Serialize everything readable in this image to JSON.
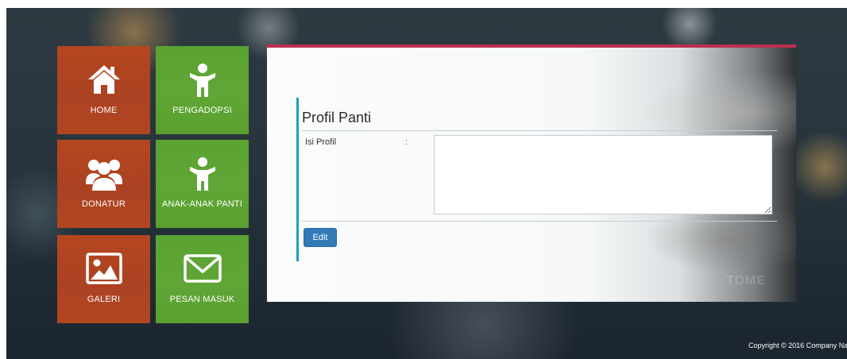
{
  "tiles": [
    {
      "label": "HOME",
      "icon": "home-icon",
      "color": "#b5461f"
    },
    {
      "label": "PENGADOPSI",
      "icon": "person-icon",
      "color": "#5aa331"
    },
    {
      "label": "DONATUR",
      "icon": "users-icon",
      "color": "#b5461f"
    },
    {
      "label": "ANAK-ANAK PANTI",
      "icon": "child-icon",
      "color": "#5aa331"
    },
    {
      "label": "GALERI",
      "icon": "image-icon",
      "color": "#b5461f"
    },
    {
      "label": "PESAN MASUK",
      "icon": "envelope-icon",
      "color": "#5aa331"
    }
  ],
  "panel": {
    "title": "Profil Panti",
    "field_label": "Isi Profil",
    "colon": ":",
    "textarea_value": "",
    "edit_label": "Edit",
    "accent_color": "#17a2b8",
    "top_border_color": "#bc2f4f",
    "watermark": "TOME"
  },
  "footer": {
    "copyright": "Copyright © 2016 Company Na"
  }
}
